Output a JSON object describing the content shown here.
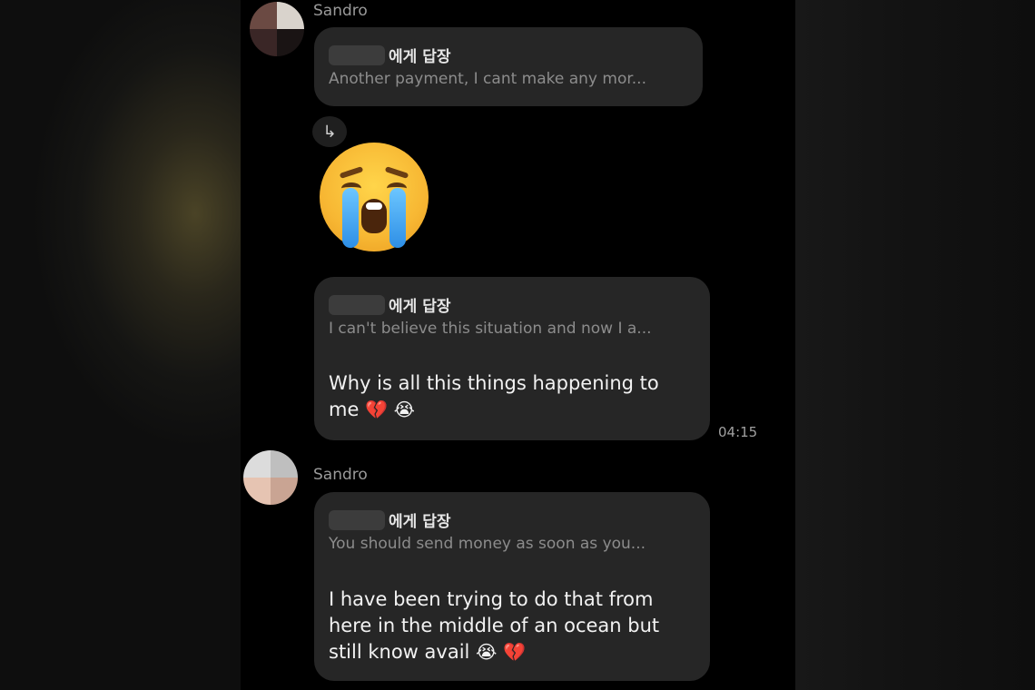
{
  "messages": [
    {
      "sender": "Sandro",
      "reply_label": "에게 답장",
      "quoted": "Another payment, I cant make any mor..."
    },
    {
      "emoji": "😭",
      "emoji_name": "loudly-crying-face"
    },
    {
      "reply_label": "에게 답장",
      "quoted": "I can't believe this situation and now I a...",
      "text_line1": "Why is all this things happening to",
      "text_line2": "me",
      "emoji_a": "💔",
      "emoji_b": "😭",
      "time": "04:15"
    },
    {
      "sender": "Sandro",
      "reply_label": "에게 답장",
      "quoted": "You should send money as soon as you...",
      "text_line1": "I have been trying to do that from",
      "text_line2": "here in the middle of an ocean but",
      "text_line3": "still know avail",
      "emoji_a": "😭",
      "emoji_b": "💔"
    }
  ],
  "icons": {
    "reply_arrow": "↳"
  },
  "colors": {
    "background": "#000000",
    "bubble": "#262626",
    "text": "#f2f2f2",
    "muted": "#8c8c8c"
  }
}
